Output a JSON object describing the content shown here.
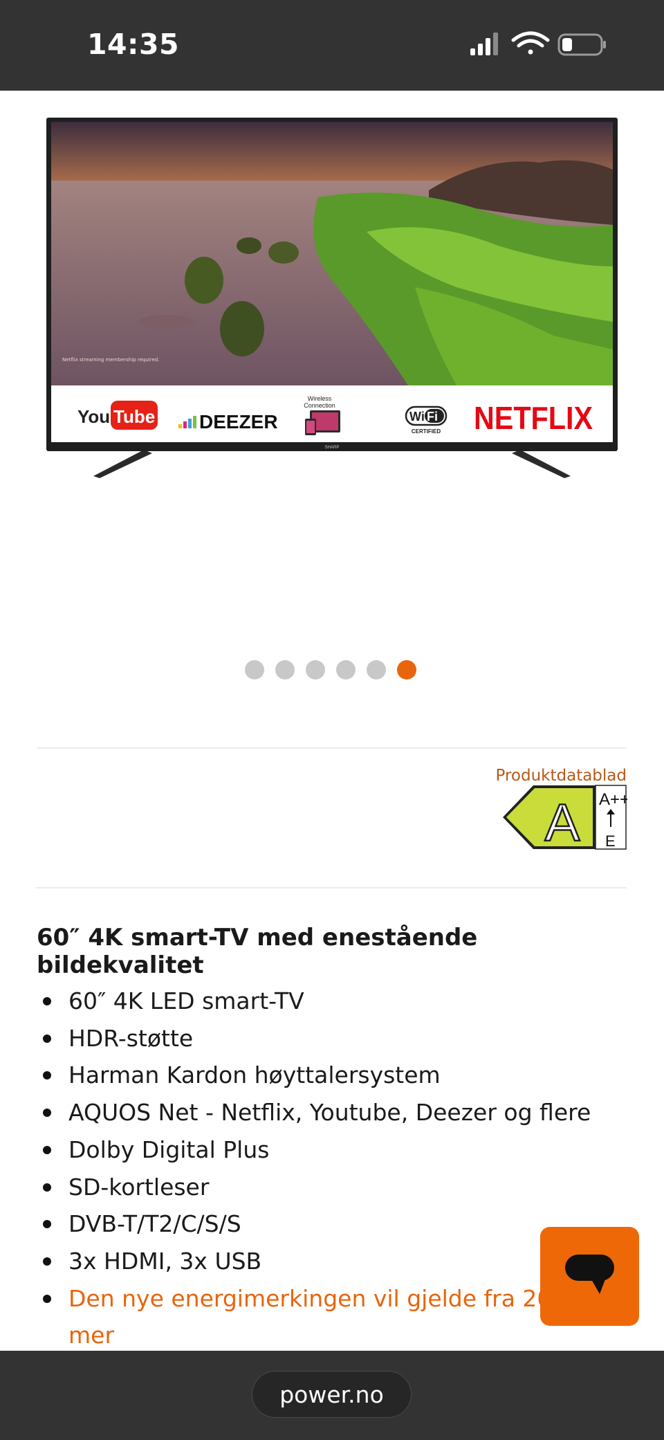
{
  "status_bar": {
    "time": "14:35"
  },
  "product_image": {
    "brand_logos": [
      "YouTube",
      "DEEZER",
      "Wireless Connection",
      "WiFi CERTIFIED",
      "NETFLIX"
    ],
    "youtube_you": "You",
    "youtube_tube": "Tube",
    "deezer": "DEEZER",
    "wireless_line1": "Wireless",
    "wireless_line2": "Connection",
    "wifi_wi": "Wi",
    "wifi_fi": "Fi",
    "wifi_certified": "CERTIFIED",
    "netflix": "NETFLIX",
    "screen_footnote": "Netflix streaming membership required.",
    "tv_brand": "SHARP"
  },
  "carousel": {
    "count": 6,
    "active_index": 5
  },
  "energy": {
    "datasheet_label": "Produktdatablad",
    "class": "A",
    "scale_top": "A++",
    "scale_bottom": "E"
  },
  "product": {
    "heading": "60″ 4K smart-TV med enestående bildekvalitet",
    "features": [
      "60″ 4K LED smart-TV",
      "HDR-støtte",
      "Harman Kardon høyttalersystem",
      "AQUOS Net - Netflix, Youtube, Deezer og flere",
      "Dolby Digital Plus",
      "SD-kortleser",
      "DVB-T/T2/C/S/S",
      "3x HDMI, 3x USB"
    ],
    "energy_notice_line1": "Den nye energimerkingen vil gjelde fra 202",
    "energy_notice_line2": "mer"
  },
  "browser": {
    "url": "power.no"
  },
  "colors": {
    "accent": "#e8650c",
    "bar": "#333333",
    "energy_green": "#c9dc3a"
  }
}
